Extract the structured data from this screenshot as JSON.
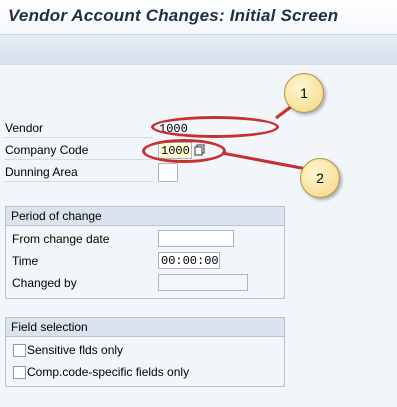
{
  "screen_title": "Vendor Account Changes: Initial Screen",
  "fields": {
    "vendor": {
      "label": "Vendor",
      "value": "1000"
    },
    "company_code": {
      "label": "Company Code",
      "value": "1000"
    },
    "dunning_area": {
      "label": "Dunning Area",
      "value": ""
    }
  },
  "period_of_change": {
    "title": "Period of change",
    "from_change_date": {
      "label": "From change date",
      "value": ""
    },
    "time": {
      "label": "Time",
      "value": "00:00:00"
    },
    "changed_by": {
      "label": "Changed by",
      "value": ""
    }
  },
  "field_selection": {
    "title": "Field selection",
    "sensitive": {
      "label": "Sensitive flds only",
      "checked": false
    },
    "company_specific": {
      "label": "Comp.code-specific fields only",
      "checked": false
    }
  },
  "callouts": [
    "1",
    "2"
  ],
  "colors": {
    "annotation_red": "#c82f2f",
    "callout_fill": "#f3d781"
  }
}
